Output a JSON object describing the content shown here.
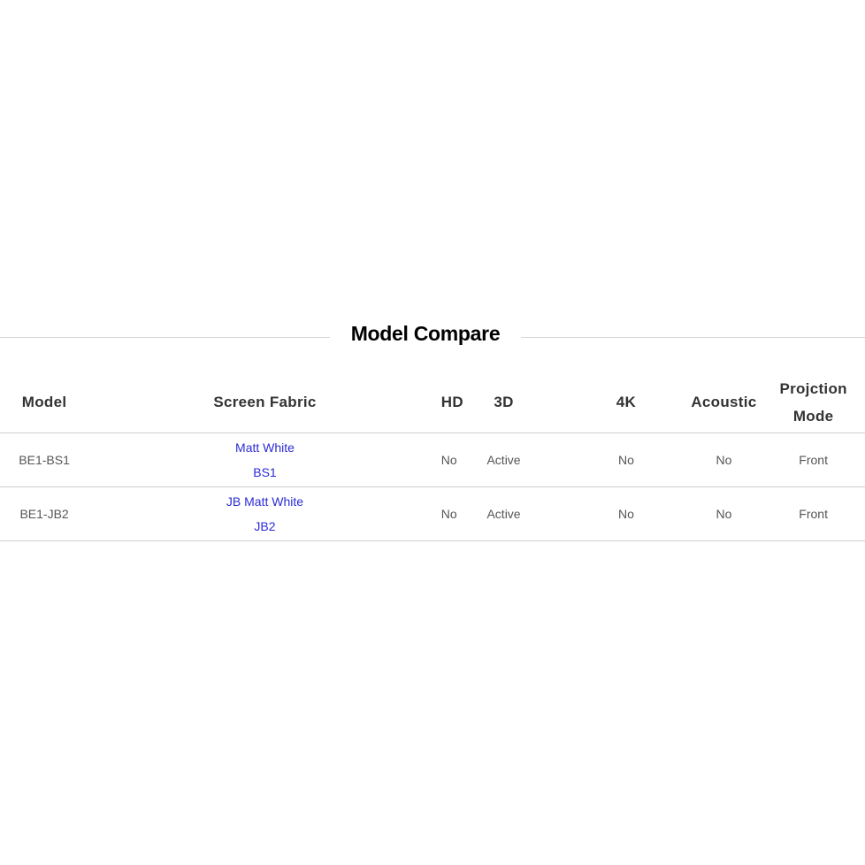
{
  "section": {
    "title": "Model Compare"
  },
  "table": {
    "headers": {
      "model": "Model",
      "screen_fabric": "Screen Fabric",
      "hd": "HD",
      "three_d": "3D",
      "four_k": "4K",
      "acoustic": "Acoustic",
      "projection_mode_line1": "Projction",
      "projection_mode_line2": "Mode"
    },
    "rows": [
      {
        "model": "BE1-BS1",
        "fabric_name": "Matt White",
        "fabric_code": "BS1",
        "hd": "No",
        "three_d": "Active",
        "four_k": "No",
        "acoustic": "No",
        "projection_mode": "Front"
      },
      {
        "model": "BE1-JB2",
        "fabric_name": "JB Matt White",
        "fabric_code": "JB2",
        "hd": "No",
        "three_d": "Active",
        "four_k": "No",
        "acoustic": "No",
        "projection_mode": "Front"
      }
    ]
  },
  "colors": {
    "link": "#2b2bd6",
    "divider": "#cfcfcf",
    "title": "#000000"
  }
}
